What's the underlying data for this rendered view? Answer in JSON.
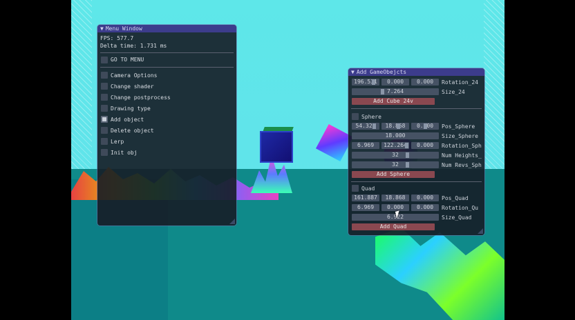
{
  "menu_window": {
    "title": "Menu Window",
    "fps": "FPS: 577.7",
    "delta": "Delta time: 1.731 ms",
    "goto_menu": "GO TO MENU",
    "options": [
      {
        "label": "Camera Options",
        "checked": false
      },
      {
        "label": "Change shader",
        "checked": false
      },
      {
        "label": "Change postprocess",
        "checked": false
      },
      {
        "label": "Drawing type",
        "checked": false
      },
      {
        "label": "Add object",
        "checked": true
      },
      {
        "label": "Delete object",
        "checked": false
      },
      {
        "label": "Lerp",
        "checked": false
      },
      {
        "label": "Init obj",
        "checked": false
      }
    ]
  },
  "add_window": {
    "title": "Add GameObejcts",
    "cube": {
      "rotation": [
        "196.531",
        "0.000",
        "0.000"
      ],
      "rotation_label": "Rotation_24",
      "size": "7.264",
      "size_label": "Size_24",
      "add_button": "Add Cube 24v"
    },
    "sphere": {
      "header": "Sphere",
      "pos": [
        "54.320",
        "18.868",
        "0.000"
      ],
      "pos_label": "Pos_Sphere",
      "size": "18.000",
      "size_label": "Size_Sphere",
      "rotation": [
        "6.969",
        "122.264",
        "0.000"
      ],
      "rotation_label": "Rotation_Sph",
      "heights": "32",
      "heights_label": "Num Heights_",
      "revs": "32",
      "revs_label": "Num Revs_Sph",
      "add_button": "Add Sphere"
    },
    "quad": {
      "header": "Quad",
      "pos": [
        "161.887",
        "18.868",
        "0.000"
      ],
      "pos_label": "Pos_Quad",
      "rotation": [
        "6.969",
        "0.000",
        "0.000"
      ],
      "rotation_label": "Rotation_Qu",
      "size": "6.922",
      "size_label": "Size_Quad",
      "add_button": "Add Quad"
    }
  },
  "colors": {
    "title_bar": "#3c3c8c",
    "button": "#8a4850",
    "field": "#465264",
    "window_bg": "#161c26",
    "sky": "#5ee7e9",
    "ground": "#0f8a8a"
  }
}
